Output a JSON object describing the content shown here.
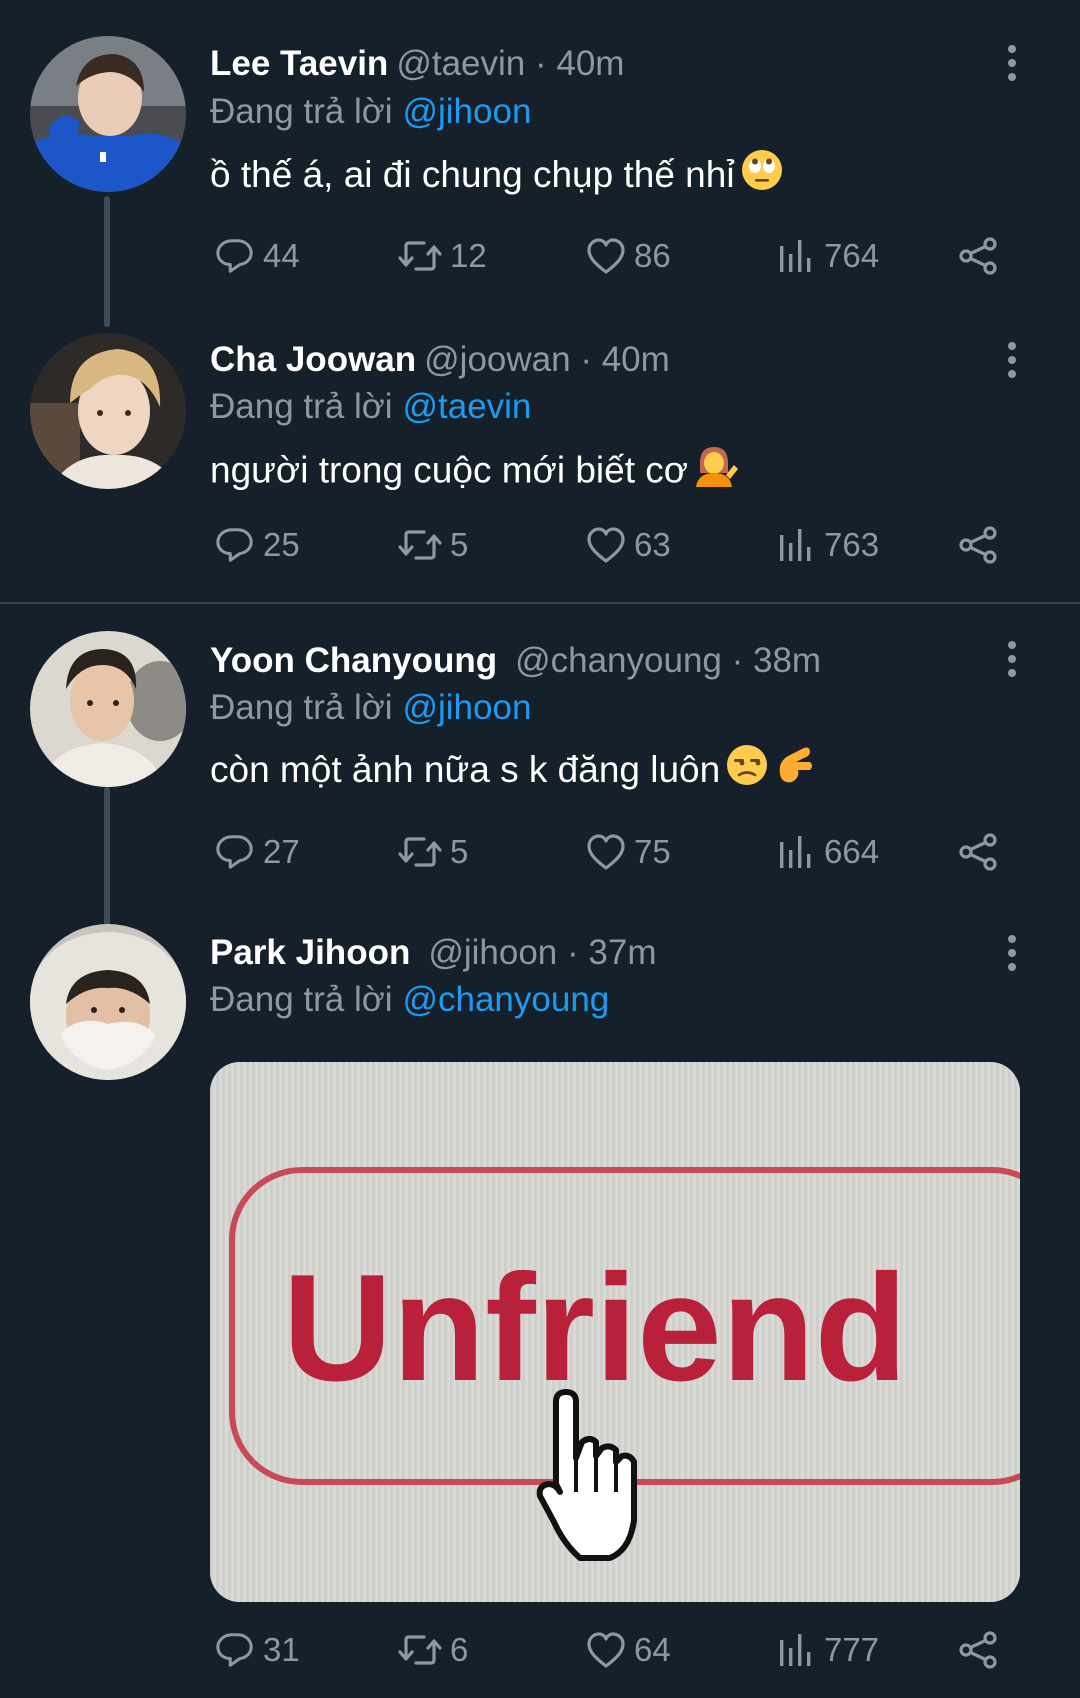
{
  "tweets": [
    {
      "name": "Lee Taevin",
      "handle": "@taevin",
      "time": "· 40m",
      "reply_prefix": "Đang trả lời",
      "reply_to": "@jihoon",
      "text": "ồ thế á, ai đi chung chụp thế nhỉ",
      "emoji": [
        "face-with-rolling-eyes"
      ],
      "stats": {
        "replies": "44",
        "retweets": "12",
        "likes": "86",
        "views": "764"
      }
    },
    {
      "name": "Cha Joowan",
      "handle": "@joowan",
      "time": "· 40m",
      "reply_prefix": "Đang trả lời",
      "reply_to": "@taevin",
      "text": "người trong cuộc mới biết cơ",
      "emoji": [
        "person-tipping-hand"
      ],
      "stats": {
        "replies": "25",
        "retweets": "5",
        "likes": "63",
        "views": "763"
      }
    },
    {
      "name": "Yoon Chanyoung",
      "handle": "@chanyoung",
      "time": "· 38m",
      "reply_prefix": "Đang trả lời",
      "reply_to": "@jihoon",
      "text": "còn một ảnh nữa s k đăng luôn",
      "emoji": [
        "unamused-face",
        "pinching-hand"
      ],
      "stats": {
        "replies": "27",
        "retweets": "5",
        "likes": "75",
        "views": "664"
      }
    },
    {
      "name": "Park Jihoon",
      "handle": "@jihoon",
      "time": "· 37m",
      "reply_prefix": "Đang trả lời",
      "reply_to": "@chanyoung",
      "media_text": "Unfriend",
      "stats": {
        "replies": "31",
        "retweets": "6",
        "likes": "64",
        "views": "777"
      }
    }
  ],
  "icons": {
    "reply": "speech-bubble-icon",
    "retweet": "retweet-icon",
    "like": "heart-icon",
    "views": "bar-chart-icon",
    "share": "share-icon",
    "more": "vertical-dots-icon"
  },
  "colors": {
    "background": "#15202b",
    "link": "#1d9bf0",
    "secondary_text": "#8b98a5",
    "divider": "#38444d"
  }
}
